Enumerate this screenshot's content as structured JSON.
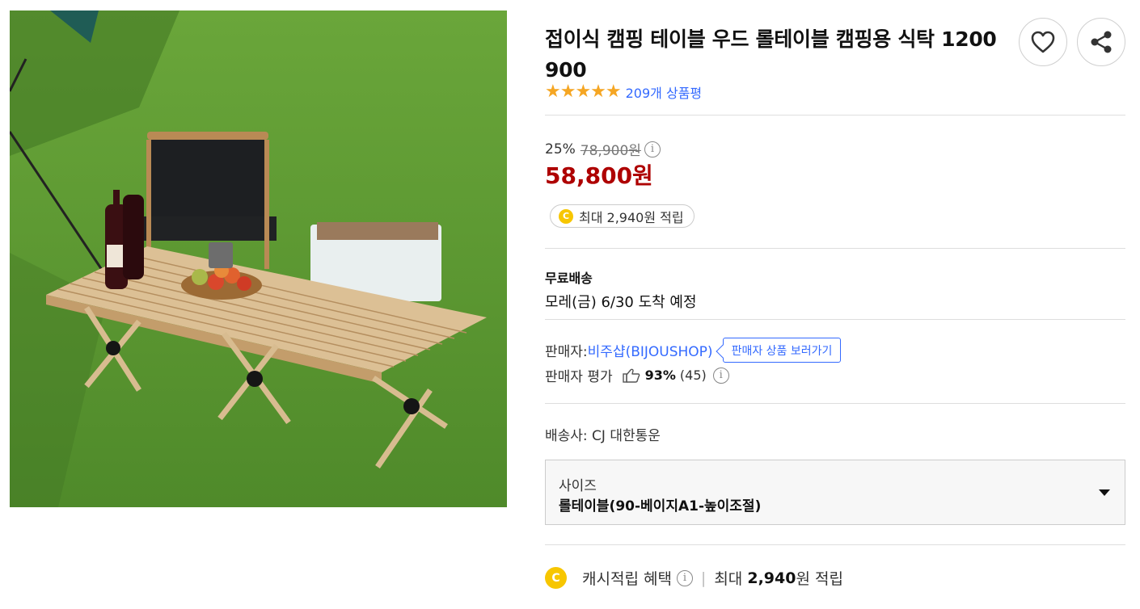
{
  "product": {
    "title": "접이식 캠핑 테이블 우드 롤테이블 캠핑용 식탁 1200 900",
    "image_alt": "camping roll table on grass",
    "stars": "★★★★★",
    "review_count": "209개 상품평",
    "rating": 5
  },
  "actions": {
    "wishlist": "heart-icon",
    "share": "share-icon"
  },
  "price": {
    "discount": "25%",
    "original": "78,900원",
    "sale": "58,800원",
    "cash_pill": "최대 2,940원 적립",
    "coin_letter": "C"
  },
  "shipping": {
    "title": "무료배송",
    "arrival": "모레(금) 6/30 도착 예정"
  },
  "seller": {
    "label": "판매자: ",
    "name": "비주샵(BIJOUSHOP)",
    "button": "판매자 상품 보러가기",
    "eval_label": "판매자 평가",
    "eval_pct": "93%",
    "eval_count": "(45)"
  },
  "carrier": "배송사: CJ 대한통운",
  "option": {
    "label": "사이즈",
    "value": "롤테이블(90-베이지A1-높이조절)"
  },
  "cash_benefit": {
    "label": "캐시적립 혜택",
    "prefix": "최대",
    "amount": "2,940",
    "suffix": "원 적립"
  },
  "colors": {
    "price_red": "#ae0000",
    "link_blue": "#346aff",
    "star": "#f5a623",
    "coin": "#f7c600"
  }
}
